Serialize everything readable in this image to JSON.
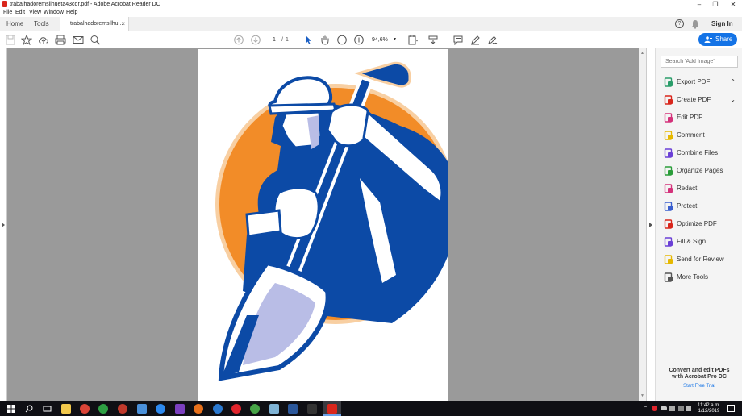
{
  "window": {
    "title": "trabalhadoremsilhueta43cdr.pdf - Adobe Acrobat Reader DC",
    "controls": [
      "–",
      "❐",
      "✕"
    ]
  },
  "menu": [
    "File",
    "Edit",
    "View",
    "Window",
    "Help"
  ],
  "tabs": {
    "home": "Home",
    "tools": "Tools",
    "document": "trabalhadoremsilhu...",
    "close": "×",
    "help_icon": "help-icon",
    "bell_icon": "notification-bell-icon",
    "sign_in": "Sign In"
  },
  "toolbar": {
    "page_current": "1",
    "page_separator": "/",
    "page_total": "1",
    "zoom": "94,6%",
    "share_label": "Share"
  },
  "right_pane": {
    "search_placeholder": "Search 'Add Image'",
    "tools": [
      {
        "label": "Export PDF",
        "color": "#2a9d6a",
        "icon": "export-pdf-icon",
        "chevron": "⌃"
      },
      {
        "label": "Create PDF",
        "color": "#d9261c",
        "icon": "create-pdf-icon",
        "chevron": "⌄"
      },
      {
        "label": "Edit PDF",
        "color": "#d4317a",
        "icon": "edit-pdf-icon"
      },
      {
        "label": "Comment",
        "color": "#e6b800",
        "icon": "comment-icon"
      },
      {
        "label": "Combine Files",
        "color": "#6a3fd6",
        "icon": "combine-files-icon"
      },
      {
        "label": "Organize Pages",
        "color": "#2a9d3a",
        "icon": "organize-pages-icon"
      },
      {
        "label": "Redact",
        "color": "#d4317a",
        "icon": "redact-icon"
      },
      {
        "label": "Protect",
        "color": "#3a5ecf",
        "icon": "protect-icon"
      },
      {
        "label": "Optimize PDF",
        "color": "#d9261c",
        "icon": "optimize-pdf-icon"
      },
      {
        "label": "Fill & Sign",
        "color": "#6a3fd6",
        "icon": "fill-sign-icon"
      },
      {
        "label": "Send for Review",
        "color": "#e6b800",
        "icon": "send-for-review-icon"
      },
      {
        "label": "More Tools",
        "color": "#555555",
        "icon": "more-tools-icon"
      }
    ],
    "promo_line1": "Convert and edit PDFs",
    "promo_line2": "with Acrobat Pro DC",
    "promo_link": "Start Free Trial"
  },
  "taskbar": {
    "time": "11:42 a.m.",
    "date": "1/12/2019"
  },
  "colors": {
    "accent": "#1473e6",
    "illustration_blue": "#0c4aa6",
    "illustration_orange": "#f28c28",
    "illustration_peach": "#f8cfa2",
    "illustration_lavender": "#b9bde6"
  }
}
